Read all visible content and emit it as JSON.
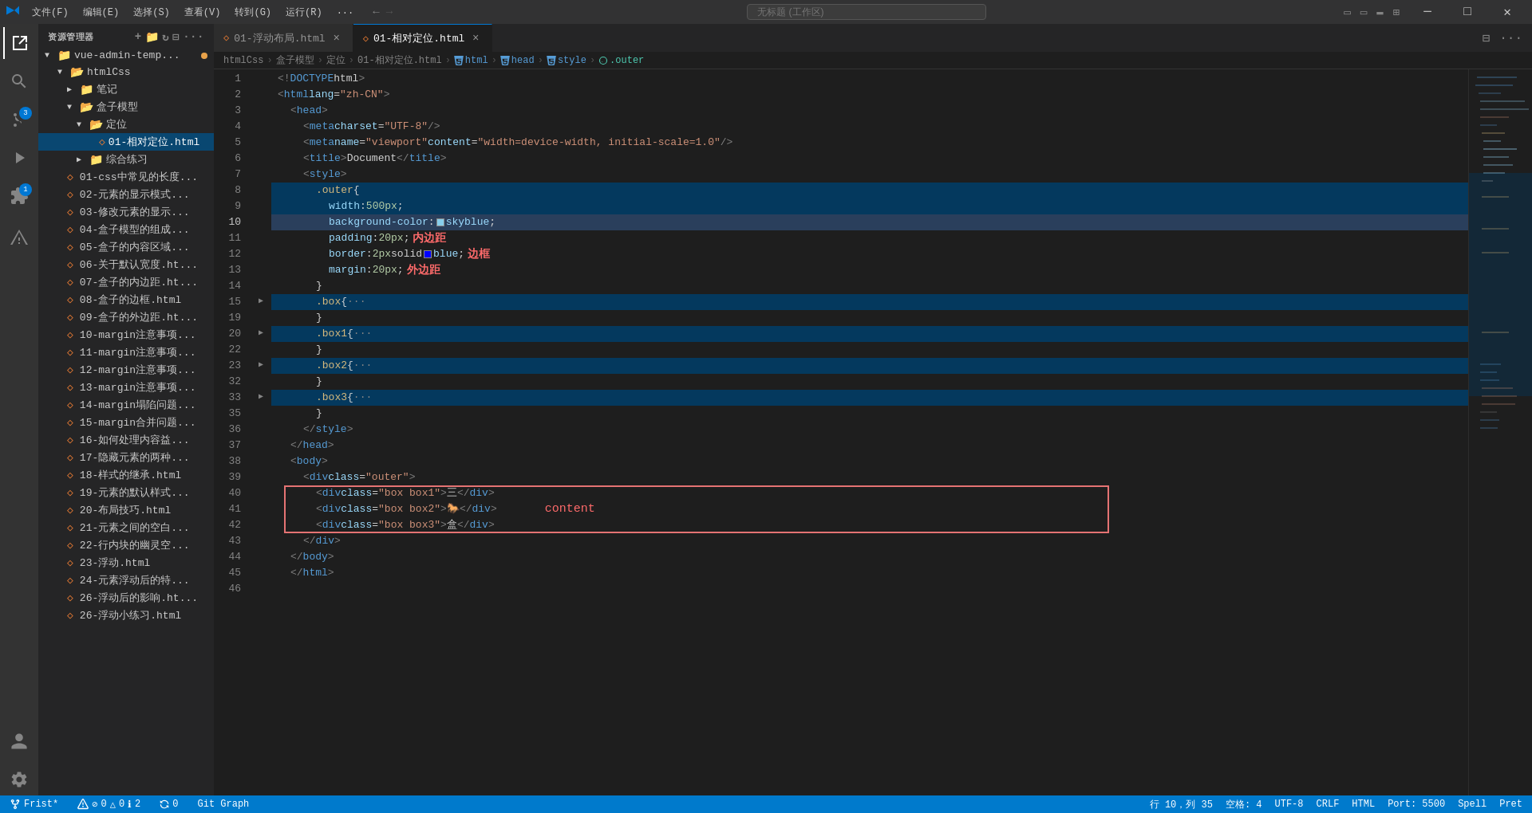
{
  "titlebar": {
    "icon": "✖",
    "menu_items": [
      "文件(F)",
      "编辑(E)",
      "选择(S)",
      "查看(V)",
      "转到(G)",
      "运行(R)",
      "..."
    ],
    "search_placeholder": "无标题 (工作区)",
    "nav_back": "←",
    "nav_fwd": "→",
    "win_icons": [
      "▭",
      "▭",
      "✕"
    ]
  },
  "activity_bar": {
    "items": [
      {
        "icon": "⎘",
        "label": "explorer-icon",
        "active": true
      },
      {
        "icon": "🔍",
        "label": "search-icon"
      },
      {
        "icon": "⑂",
        "label": "source-control-icon",
        "badge": "3"
      },
      {
        "icon": "▷",
        "label": "run-icon"
      },
      {
        "icon": "⧉",
        "label": "extensions-icon",
        "badge": "1"
      },
      {
        "icon": "△",
        "label": "alert-icon"
      }
    ],
    "bottom_items": [
      {
        "icon": "👤",
        "label": "account-icon"
      },
      {
        "icon": "⚙",
        "label": "settings-icon"
      }
    ]
  },
  "sidebar": {
    "explorer_label": "资源管理器",
    "vue_admin": "vue-admin-temp...",
    "items": [
      {
        "label": "htmlCss",
        "type": "folder_open",
        "indent": 0
      },
      {
        "label": "笔记",
        "type": "folder_closed",
        "indent": 1
      },
      {
        "label": "盒子模型",
        "type": "folder_open",
        "indent": 1
      },
      {
        "label": "定位",
        "type": "folder_open",
        "indent": 2
      },
      {
        "label": "01-相对定位.html",
        "type": "file_active",
        "indent": 3
      },
      {
        "label": "综合练习",
        "type": "folder_closed",
        "indent": 2
      },
      {
        "label": "01-css中常见的长度...",
        "type": "file",
        "indent": 1
      },
      {
        "label": "02-元素的显示模式...",
        "type": "file",
        "indent": 1
      },
      {
        "label": "03-修改元素的显示...",
        "type": "file",
        "indent": 1
      },
      {
        "label": "04-盒子模型的组成...",
        "type": "file",
        "indent": 1
      },
      {
        "label": "05-盒子的内容区域...",
        "type": "file",
        "indent": 1
      },
      {
        "label": "06-关于默认宽度.ht...",
        "type": "file",
        "indent": 1
      },
      {
        "label": "07-盒子的内边距.ht...",
        "type": "file",
        "indent": 1
      },
      {
        "label": "08-盒子的边框.html",
        "type": "file",
        "indent": 1
      },
      {
        "label": "09-盒子的外边距.ht...",
        "type": "file",
        "indent": 1
      },
      {
        "label": "10-margin注意事项...",
        "type": "file",
        "indent": 1
      },
      {
        "label": "11-margin注意事项...",
        "type": "file",
        "indent": 1
      },
      {
        "label": "12-margin注意事项...",
        "type": "file",
        "indent": 1
      },
      {
        "label": "13-margin注意事项...",
        "type": "file",
        "indent": 1
      },
      {
        "label": "14-margin塌陷问题...",
        "type": "file",
        "indent": 1
      },
      {
        "label": "15-margin合并问题...",
        "type": "file",
        "indent": 1
      },
      {
        "label": "16-如何处理内容益...",
        "type": "file",
        "indent": 1
      },
      {
        "label": "17-隐藏元素的两种...",
        "type": "file",
        "indent": 1
      },
      {
        "label": "18-样式的继承.html",
        "type": "file",
        "indent": 1
      },
      {
        "label": "19-元素的默认样式...",
        "type": "file",
        "indent": 1
      },
      {
        "label": "20-布局技巧.html",
        "type": "file",
        "indent": 1
      },
      {
        "label": "21-元素之间的空白...",
        "type": "file",
        "indent": 1
      },
      {
        "label": "22-行内块的幽灵空...",
        "type": "file",
        "indent": 1
      },
      {
        "label": "23-浮动.html",
        "type": "file",
        "indent": 1
      },
      {
        "label": "24-元素浮动后的特...",
        "type": "file",
        "indent": 1
      },
      {
        "label": "26-浮动后的影响.ht...",
        "type": "file",
        "indent": 1
      },
      {
        "label": "26-浮动小练习.html",
        "type": "file",
        "indent": 1
      }
    ]
  },
  "tabs": [
    {
      "label": "01-浮动布局.html",
      "active": false,
      "icon": "◇",
      "modified": false
    },
    {
      "label": "01-相对定位.html",
      "active": true,
      "icon": "◇",
      "modified": true
    }
  ],
  "breadcrumb": {
    "items": [
      "htmlCss",
      ">",
      "盒子模型",
      ">",
      "定位",
      ">",
      "01-相对定位.html",
      ">",
      "html",
      ">",
      "head",
      ">",
      "style",
      ">",
      ".outer"
    ]
  },
  "code_lines": [
    {
      "num": 1,
      "content": "<!DOCTYPE html>"
    },
    {
      "num": 2,
      "content": "<html lang=\"zh-CN\">"
    },
    {
      "num": 3,
      "content": "  <head>"
    },
    {
      "num": 4,
      "content": "    <meta charset=\"UTF-8\" />"
    },
    {
      "num": 5,
      "content": "    <meta name=\"viewport\" content=\"width=device-width, initial-scale=1.0\" />"
    },
    {
      "num": 6,
      "content": "    <title>Document</title>"
    },
    {
      "num": 7,
      "content": "    <style>"
    },
    {
      "num": 8,
      "content": "      .outer {"
    },
    {
      "num": 9,
      "content": "        width: 500px;"
    },
    {
      "num": 10,
      "content": "        background-color:  skyblue;",
      "highlight": true
    },
    {
      "num": 11,
      "content": "        padding: 20px;  内边距"
    },
    {
      "num": 12,
      "content": "        border: 2px solid  blue;  边框"
    },
    {
      "num": 13,
      "content": "        margin: 20px;  外边距"
    },
    {
      "num": 14,
      "content": "      }"
    },
    {
      "num": 15,
      "content": "      .box { ···",
      "foldable": true
    },
    {
      "num": 19,
      "content": "      }"
    },
    {
      "num": 20,
      "content": "      .box1 { ···",
      "foldable": true
    },
    {
      "num": 22,
      "content": "      }"
    },
    {
      "num": 23,
      "content": "      .box2 { ···",
      "foldable": true
    },
    {
      "num": 32,
      "content": "      }"
    },
    {
      "num": 33,
      "content": "      .box3 { ···",
      "foldable": true
    },
    {
      "num": 35,
      "content": "      }"
    },
    {
      "num": 36,
      "content": "    </style>"
    },
    {
      "num": 37,
      "content": "  </head>"
    },
    {
      "num": 38,
      "content": "  <body>"
    },
    {
      "num": 39,
      "content": "    <div class=\"outer\">"
    },
    {
      "num": 40,
      "content": "      <div class=\"box box1\">三</div>"
    },
    {
      "num": 41,
      "content": "      <div class=\"box box2\">🐎</div>"
    },
    {
      "num": 42,
      "content": "      <div class=\"box box3\">盒</div>"
    },
    {
      "num": 43,
      "content": "    </div>"
    },
    {
      "num": 44,
      "content": "  </body>"
    },
    {
      "num": 45,
      "content": "  </html>"
    },
    {
      "num": 46,
      "content": ""
    }
  ],
  "annotations": {
    "padding_label": "内边距",
    "border_label": "边框",
    "margin_label": "外边距",
    "content_label": "content"
  },
  "status_bar": {
    "branch": "Frist*",
    "errors": "0",
    "warnings": "0",
    "info": "2",
    "git": "0",
    "position": "行 10，列 35",
    "spaces": "空格: 4",
    "encoding": "UTF-8",
    "line_ending": "CRLF",
    "language": "HTML",
    "port": "Port: 5500",
    "spell": "Spell",
    "prettier": "Pret"
  }
}
